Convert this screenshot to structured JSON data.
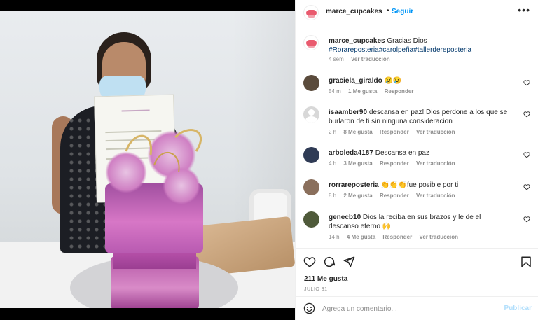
{
  "post": {
    "author": "marce_cupcakes",
    "follow_label": "Seguir",
    "dot": "•",
    "more_label": "•••",
    "caption_text": "Gracias Dios",
    "hashtags": "#Rorareposteria#carolpeña#tallerdereposteria",
    "caption_time": "4 sem",
    "caption_translate": "Ver traducción"
  },
  "comments": [
    {
      "user": "graciela_giraldo",
      "text": "😢😢",
      "time": "54 m",
      "likes": "1 Me gusta",
      "reply": "Responder",
      "translate": "",
      "avatar_color": "#5a4b3c"
    },
    {
      "user": "isaamber90",
      "text": "descansa en paz! Dios perdone a los que se burlaron de ti sin ninguna consideracion",
      "time": "2 h",
      "likes": "8 Me gusta",
      "reply": "Responder",
      "translate": "Ver traducción",
      "avatar_color": "#c8c8c8"
    },
    {
      "user": "arboleda4187",
      "text": "Descansa en paz",
      "time": "4 h",
      "likes": "3 Me gusta",
      "reply": "Responder",
      "translate": "Ver traducción",
      "avatar_color": "#2f3b55"
    },
    {
      "user": "rorrareposteria",
      "text": "👏👏👏fue posible por ti",
      "time": "8 h",
      "likes": "2 Me gusta",
      "reply": "Responder",
      "translate": "Ver traducción",
      "avatar_color": "#8a6f5c"
    },
    {
      "user": "genecb10",
      "text": "Dios la reciba en sus brazos y le de el descanso eterno 🙌",
      "time": "14 h",
      "likes": "4 Me gusta",
      "reply": "Responder",
      "translate": "Ver traducción",
      "avatar_color": "#4f5a3a"
    }
  ],
  "footer": {
    "likes": "211 Me gusta",
    "date": "JULIO 31",
    "comment_placeholder": "Agrega un comentario...",
    "publish_label": "Publicar"
  },
  "colors": {
    "link_blue": "#0095f6",
    "hashtag": "#00376b",
    "muted": "#8e8e8e",
    "publish_disabled": "#b2dffc"
  }
}
